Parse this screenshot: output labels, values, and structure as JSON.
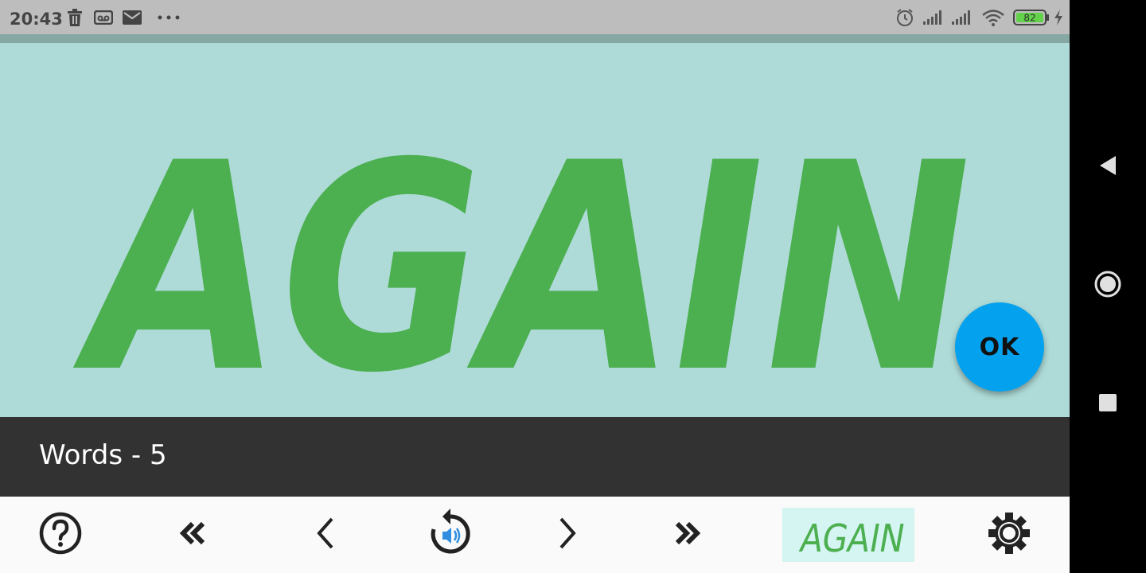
{
  "status_bar": {
    "time": "20:43",
    "battery_level": "82",
    "icons": [
      "trash-icon",
      "voicemail-icon",
      "mail-icon",
      "more-dots-icon",
      "alarm-icon",
      "signal-icon",
      "signal-icon",
      "wifi-icon",
      "battery-icon",
      "charging-icon"
    ]
  },
  "card": {
    "word": "AGAIN",
    "ok_label": "OK",
    "word_color": "#4caf50",
    "background": "#aedbd8",
    "ok_color": "#04a2ee"
  },
  "info_bar": {
    "words_label": "Words - 5"
  },
  "toolbar": {
    "buttons": [
      "help-icon",
      "first-icon",
      "previous-icon",
      "replay-audio-icon",
      "next-icon",
      "last-icon",
      "word-thumbnail",
      "settings-icon"
    ],
    "thumbnail_word": "AGAIN"
  },
  "nav_bar": {
    "buttons": [
      "back-icon",
      "home-icon",
      "recents-icon"
    ]
  }
}
